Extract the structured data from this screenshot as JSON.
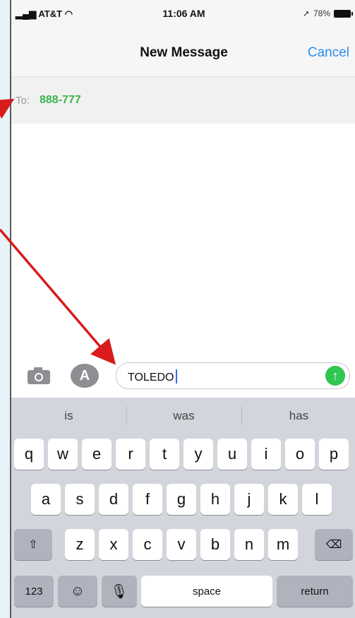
{
  "status": {
    "carrier": "AT&T",
    "time": "11:06 AM",
    "battery": "78%"
  },
  "nav": {
    "title": "New Message",
    "cancel": "Cancel"
  },
  "to": {
    "label": "To:",
    "recipient": "888-777"
  },
  "compose": {
    "text": "TOLEDO",
    "send_icon": "arrow-up-icon"
  },
  "suggestions": [
    "is",
    "was",
    "has"
  ],
  "keyboard": {
    "row1": [
      "q",
      "w",
      "e",
      "r",
      "t",
      "y",
      "u",
      "i",
      "o",
      "p"
    ],
    "row2": [
      "a",
      "s",
      "d",
      "f",
      "g",
      "h",
      "j",
      "k",
      "l"
    ],
    "row3": [
      "z",
      "x",
      "c",
      "v",
      "b",
      "n",
      "m"
    ],
    "numbers": "123",
    "space": "space",
    "return": "return"
  },
  "colors": {
    "accent": "#2d8cf0",
    "recipient": "#3bb54a",
    "send": "#2fc652",
    "annotation": "#d91b1b"
  }
}
